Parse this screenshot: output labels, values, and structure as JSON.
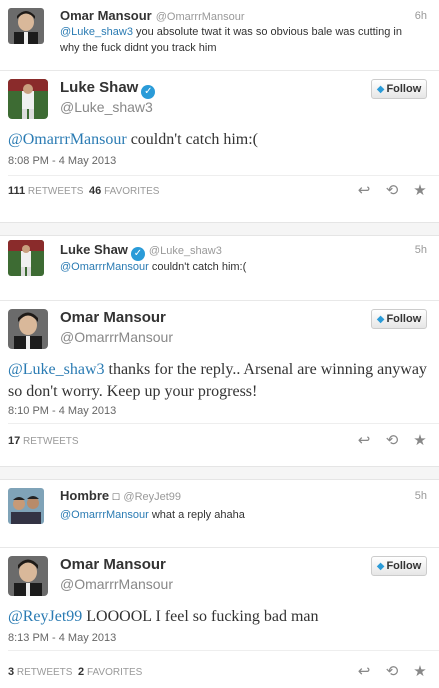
{
  "reply1": {
    "name": "Omar Mansour",
    "handle": "@OmarrrMansour",
    "time": "6h",
    "mention": "@Luke_shaw3",
    "text": " you absolute twat it was so obvious bale was cutting in why the fuck didnt you track him"
  },
  "tweet1": {
    "name": "Luke Shaw",
    "handle": "@Luke_shaw3",
    "follow": "Follow",
    "mention": "@OmarrrMansour",
    "text": " couldn't catch him:(",
    "date": "8:08 PM - 4 May 2013",
    "retweets": "111",
    "retweets_label": "RETWEETS",
    "favorites": "46",
    "favorites_label": "FAVORITES"
  },
  "reply2": {
    "name": "Luke Shaw",
    "handle": "@Luke_shaw3",
    "time": "5h",
    "mention": "@OmarrrMansour",
    "text": " couldn't catch him:("
  },
  "tweet2": {
    "name": "Omar Mansour",
    "handle": "@OmarrrMansour",
    "follow": "Follow",
    "mention": "@Luke_shaw3",
    "text": " thanks for the reply.. Arsenal are winning anyway so don't worry. Keep up your progress!",
    "date": "8:10 PM - 4 May 2013",
    "retweets": "17",
    "retweets_label": "RETWEETS"
  },
  "reply3": {
    "name": "Hombre",
    "name_suffix": "□",
    "handle": "@ReyJet99",
    "time": "5h",
    "mention": "@OmarrrMansour",
    "text": " what a reply ahaha"
  },
  "tweet3": {
    "name": "Omar Mansour",
    "handle": "@OmarrrMansour",
    "follow": "Follow",
    "mention": "@ReyJet99",
    "text": " LOOOOL I feel so fucking bad man",
    "date": "8:13 PM - 4 May 2013",
    "retweets": "3",
    "retweets_label": "RETWEETS",
    "favorites": "2",
    "favorites_label": "FAVORITES"
  },
  "icons": {
    "reply": "reply-icon",
    "retweet": "retweet-icon",
    "favorite": "star-icon",
    "bird": "twitter-bird-icon",
    "verified": "verified-badge-icon"
  },
  "colors": {
    "link": "#2a7bb3",
    "verified": "#2a9bd8"
  }
}
